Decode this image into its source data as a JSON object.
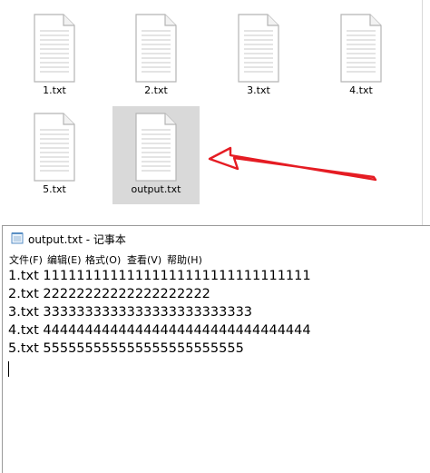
{
  "explorer": {
    "files": [
      {
        "name": "1.txt",
        "selected": false
      },
      {
        "name": "2.txt",
        "selected": false
      },
      {
        "name": "3.txt",
        "selected": false
      },
      {
        "name": "4.txt",
        "selected": false
      },
      {
        "name": "5.txt",
        "selected": false
      },
      {
        "name": "output.txt",
        "selected": true
      }
    ],
    "annotation_color": "#e51c23"
  },
  "notepad": {
    "title": "output.txt - 记事本",
    "menu": [
      "文件(F)",
      "编辑(E)",
      "格式(O)",
      "查看(V)",
      "帮助(H)"
    ],
    "lines": [
      "1.txt 11111111111111111111111111111111",
      "2.txt 22222222222222222222",
      "3.txt 3333333333333333333333333",
      "4.txt 44444444444444444444444444444444",
      "5.txt 555555555555555555555555"
    ]
  }
}
